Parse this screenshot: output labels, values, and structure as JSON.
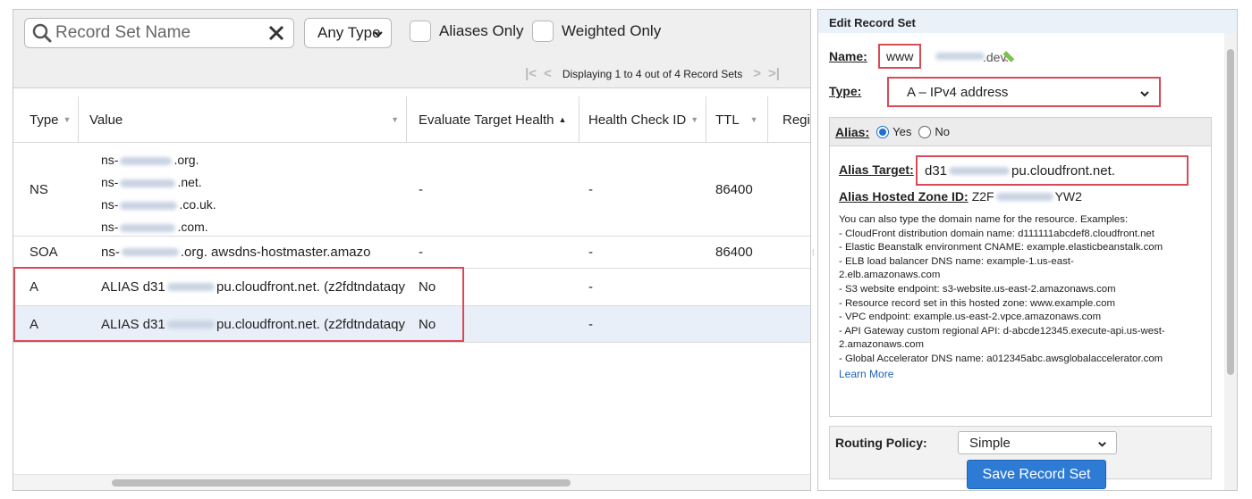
{
  "toolbar": {
    "search_placeholder": "Record Set Name",
    "type_filter": "Any Type",
    "aliases_only": "Aliases Only",
    "weighted_only": "Weighted Only",
    "pager_text": "Displaying 1 to 4 out of 4 Record Sets"
  },
  "table": {
    "columns": [
      "Type",
      "Value",
      "Evaluate Target Health",
      "Health Check ID",
      "TTL",
      "Regio"
    ],
    "rows": [
      {
        "type": "NS",
        "values": [
          {
            "prefix": "ns-",
            "suffix": ".org."
          },
          {
            "prefix": "ns-",
            "suffix": ".net."
          },
          {
            "prefix": "ns-",
            "suffix": ".co.uk."
          },
          {
            "prefix": "ns-",
            "suffix": ".com."
          }
        ],
        "eval": "-",
        "health": "-",
        "ttl": "86400"
      },
      {
        "type": "SOA",
        "value_prefix": "ns-",
        "value_suffix": ".org. awsdns-hostmaster.amazo",
        "eval": "-",
        "health": "-",
        "ttl": "86400"
      },
      {
        "type": "A",
        "value_prefix": "ALIAS d31",
        "value_suffix": "pu.cloudfront.net. (z2fdtndataqy",
        "eval": "No",
        "health": "-",
        "ttl": ""
      },
      {
        "type": "A",
        "value_prefix": "ALIAS d31",
        "value_suffix": "pu.cloudfront.net. (z2fdtndataqy",
        "eval": "No",
        "health": "-",
        "ttl": ""
      }
    ]
  },
  "panel": {
    "title": "Edit Record Set",
    "name_label": "Name:",
    "name_value": "www",
    "name_suffix": ".dev.",
    "type_label": "Type:",
    "type_value": "A – IPv4 address",
    "alias_label": "Alias:",
    "alias_yes": "Yes",
    "alias_no": "No",
    "alias_target_label": "Alias Target:",
    "alias_target_prefix": "d31",
    "alias_target_suffix": "pu.cloudfront.net.",
    "hosted_zone_label": "Alias Hosted Zone ID:",
    "hosted_zone_prefix": "Z2F",
    "hosted_zone_suffix": "YW2",
    "help_intro": "You can also type the domain name for the resource. Examples:",
    "help_items": [
      "-  CloudFront distribution domain name: d111111abcdef8.cloudfront.net",
      "-  Elastic Beanstalk environment CNAME: example.elasticbeanstalk.com",
      "-  ELB load balancer DNS name: example-1.us-east-",
      "2.elb.amazonaws.com",
      "-  S3 website endpoint: s3-website.us-east-2.amazonaws.com",
      "-  Resource record set in this hosted zone: www.example.com",
      "-  VPC endpoint: example.us-east-2.vpce.amazonaws.com",
      "-  API Gateway custom regional API: d-abcde12345.execute-api.us-west-",
      "2.amazonaws.com",
      "-  Global Accelerator DNS name: a012345abc.awsglobalaccelerator.com"
    ],
    "learn_more": "Learn More",
    "routing_label": "Routing Policy:",
    "routing_value": "Simple",
    "save_label": "Save Record Set"
  },
  "colors": {
    "highlight": "#d94a57",
    "selected_row": "#e8eff8",
    "primary_button": "#2e7bd5",
    "link": "#1f63b8"
  }
}
